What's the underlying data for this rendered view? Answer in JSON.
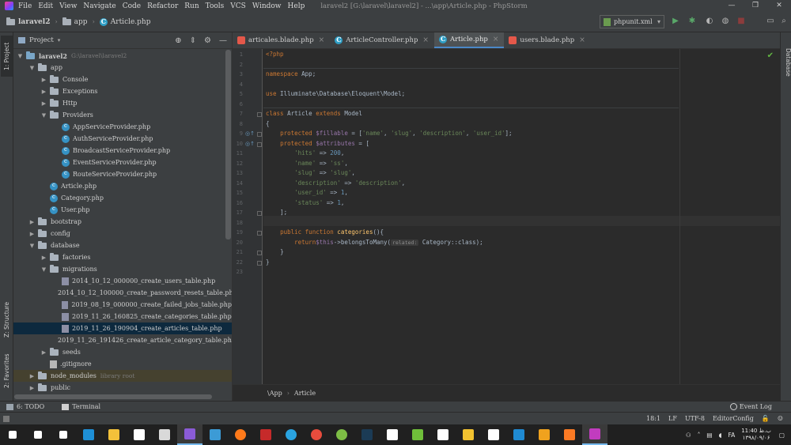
{
  "window": {
    "menu": [
      "File",
      "Edit",
      "View",
      "Navigate",
      "Code",
      "Refactor",
      "Run",
      "Tools",
      "VCS",
      "Window",
      "Help"
    ],
    "title": "laravel2 [G:\\laravel\\laravel2] - ...\\app\\Article.php - PhpStorm",
    "controls": [
      "—",
      "❐",
      "✕"
    ]
  },
  "navbar": {
    "crumbs": [
      "laravel2",
      "app",
      "Article.php"
    ],
    "run_config": "phpunit.xml"
  },
  "left_strip": {
    "project_tab": "1: Project",
    "structure_tab": "Z: Structure",
    "favorites_tab": "2: Favorites"
  },
  "right_strip": {
    "database_tab": "Database"
  },
  "project_panel": {
    "title": "Project",
    "tree": [
      {
        "label": "laravel2",
        "hint": "G:\\laravel\\laravel2",
        "depth": 0,
        "type": "folder",
        "state": "open"
      },
      {
        "label": "app",
        "depth": 1,
        "type": "folder",
        "state": "open"
      },
      {
        "label": "Console",
        "depth": 2,
        "type": "folder",
        "state": "closed"
      },
      {
        "label": "Exceptions",
        "depth": 2,
        "type": "folder",
        "state": "closed"
      },
      {
        "label": "Http",
        "depth": 2,
        "type": "folder",
        "state": "closed"
      },
      {
        "label": "Providers",
        "depth": 2,
        "type": "folder",
        "state": "open"
      },
      {
        "label": "AppServiceProvider.php",
        "depth": 3,
        "type": "class"
      },
      {
        "label": "AuthServiceProvider.php",
        "depth": 3,
        "type": "class"
      },
      {
        "label": "BroadcastServiceProvider.php",
        "depth": 3,
        "type": "class"
      },
      {
        "label": "EventServiceProvider.php",
        "depth": 3,
        "type": "class"
      },
      {
        "label": "RouteServiceProvider.php",
        "depth": 3,
        "type": "class"
      },
      {
        "label": "Article.php",
        "depth": 2,
        "type": "class"
      },
      {
        "label": "Category.php",
        "depth": 2,
        "type": "class"
      },
      {
        "label": "User.php",
        "depth": 2,
        "type": "class"
      },
      {
        "label": "bootstrap",
        "depth": 1,
        "type": "folder",
        "state": "closed"
      },
      {
        "label": "config",
        "depth": 1,
        "type": "folder",
        "state": "closed"
      },
      {
        "label": "database",
        "depth": 1,
        "type": "folder",
        "state": "open"
      },
      {
        "label": "factories",
        "depth": 2,
        "type": "folder",
        "state": "closed"
      },
      {
        "label": "migrations",
        "depth": 2,
        "type": "folder",
        "state": "open"
      },
      {
        "label": "2014_10_12_000000_create_users_table.php",
        "depth": 3,
        "type": "phpfile"
      },
      {
        "label": "2014_10_12_100000_create_password_resets_table.php",
        "depth": 3,
        "type": "phpfile"
      },
      {
        "label": "2019_08_19_000000_create_failed_jobs_table.php",
        "depth": 3,
        "type": "phpfile"
      },
      {
        "label": "2019_11_26_160825_create_categories_table.php",
        "depth": 3,
        "type": "phpfile"
      },
      {
        "label": "2019_11_26_190904_create_articles_table.php",
        "depth": 3,
        "type": "phpfile",
        "selected": true
      },
      {
        "label": "2019_11_26_191426_create_article_category_table.php",
        "depth": 3,
        "type": "phpfile"
      },
      {
        "label": "seeds",
        "depth": 2,
        "type": "folder",
        "state": "closed"
      },
      {
        "label": ".gitignore",
        "depth": 2,
        "type": "file"
      },
      {
        "label": "node_modules",
        "hint": "library root",
        "depth": 1,
        "type": "folder",
        "state": "closed",
        "highlight": true
      },
      {
        "label": "public",
        "depth": 1,
        "type": "folder",
        "state": "closed"
      }
    ]
  },
  "editor": {
    "tabs": [
      {
        "label": "articales.blade.php",
        "kind": "blade"
      },
      {
        "label": "ArticleController.php",
        "kind": "class"
      },
      {
        "label": "Article.php",
        "kind": "class",
        "active": true
      },
      {
        "label": "users.blade.php",
        "kind": "blade"
      }
    ],
    "line_numbers": [
      "1",
      "2",
      "3",
      "4",
      "5",
      "6",
      "7",
      "8",
      "9",
      "10",
      "11",
      "12",
      "13",
      "14",
      "15",
      "16",
      "17",
      "18",
      "19",
      "20",
      "21",
      "22",
      "23"
    ],
    "code": {
      "l1": "<?php",
      "l3_kw": "namespace",
      "l3_rest": " App;",
      "l5_kw": "use",
      "l5_rest": " Illuminate\\Database\\Eloquent\\Model;",
      "l7_kw1": "class",
      "l7_name": " Article ",
      "l7_kw2": "extends",
      "l7_rest": " Model",
      "l8": "{",
      "l9_kw": "protected",
      "l9_var": " $fillable",
      "l9_a": " = [",
      "l9_s1": "'name'",
      "l9_s2": "'slug'",
      "l9_s3": "'description'",
      "l9_s4": "'user_id'",
      "l9_end": "];",
      "l10_kw": "protected",
      "l10_var": " $attributes",
      "l10_a": " = [",
      "l11_k": "'hits'",
      "l11_v": "200",
      "l12_k": "'name'",
      "l12_v": "'ss'",
      "l13_k": "'slug'",
      "l13_v": "'slug'",
      "l14_k": "'description'",
      "l14_v": "'description'",
      "l15_k": "'user_id'",
      "l15_v": "1",
      "l16_k": "'status'",
      "l16_v": "1",
      "l17": "];",
      "l19_kw": "public function",
      "l19_fn": " categories",
      "l19_rest": "(){",
      "l20_kw": "return",
      "l20_var": "$this",
      "l20_call": "->belongsToMany(",
      "l20_hint": "related:",
      "l20_rest": "Category::class);",
      "l21": "}",
      "l22": "}"
    },
    "breadcrumb": [
      "\\App",
      "Article"
    ]
  },
  "bottom_tools": {
    "todo": "6: TODO",
    "terminal": "Terminal",
    "event_log": "Event Log"
  },
  "statusbar": {
    "position": "18:1",
    "line_sep": "LF",
    "encoding": "UTF-8",
    "editor_config": "EditorConfig"
  },
  "taskbar": {
    "clock_time": "11:40 ب.ظ",
    "clock_date": "۱۳۹۸/۰۹/۰۶",
    "lang": "FA",
    "icons": [
      "windows-start",
      "search",
      "task-view",
      "edge",
      "file-explorer",
      "store",
      "calculator",
      "visual-studio",
      "charts",
      "firefox",
      "flag",
      "telegram",
      "chrome",
      "android",
      "phone",
      "mail",
      "browser",
      "notepad",
      "paint",
      "files",
      "vscode",
      "bookshelf",
      "xampp",
      "phpstorm"
    ]
  },
  "colors": {
    "accent": "#4a88c7",
    "keyword": "#cc7832",
    "string": "#6a8759",
    "variable": "#9876aa",
    "number": "#6897bb",
    "function": "#ffc66d"
  }
}
